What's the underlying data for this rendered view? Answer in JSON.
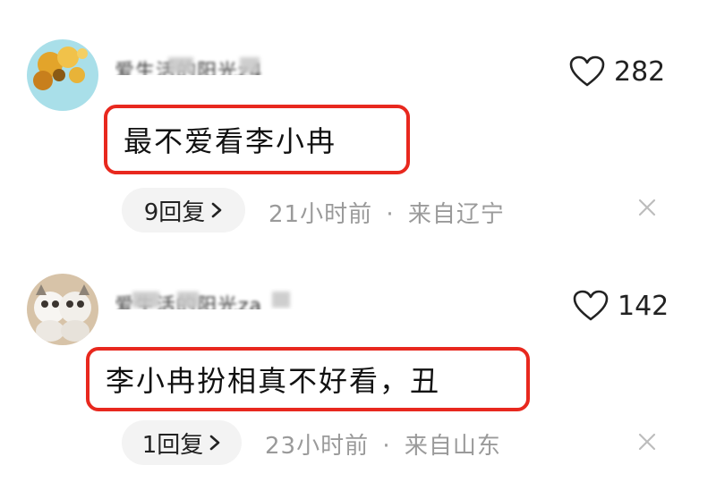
{
  "comments": [
    {
      "username": "爱生活的阳光z4",
      "likes": "282",
      "body": "最不爱看李小冉",
      "reply_count_label": "9回复",
      "time": "21小时前",
      "separator": "·",
      "location": "来自辽宁"
    },
    {
      "username": "爱生活的阳光za",
      "likes": "142",
      "body": "李小冉扮相真不好看，丑",
      "reply_count_label": "1回复",
      "time": "23小时前",
      "separator": "·",
      "location": "来自山东"
    }
  ],
  "icons": {
    "like": "heart-outline-icon",
    "reply_arrow": "chevron-right-icon",
    "dismiss": "close-icon"
  },
  "colors": {
    "highlight_border": "#e8281e",
    "meta_text": "#9a9a9a",
    "pill_bg": "#f3f3f3"
  }
}
